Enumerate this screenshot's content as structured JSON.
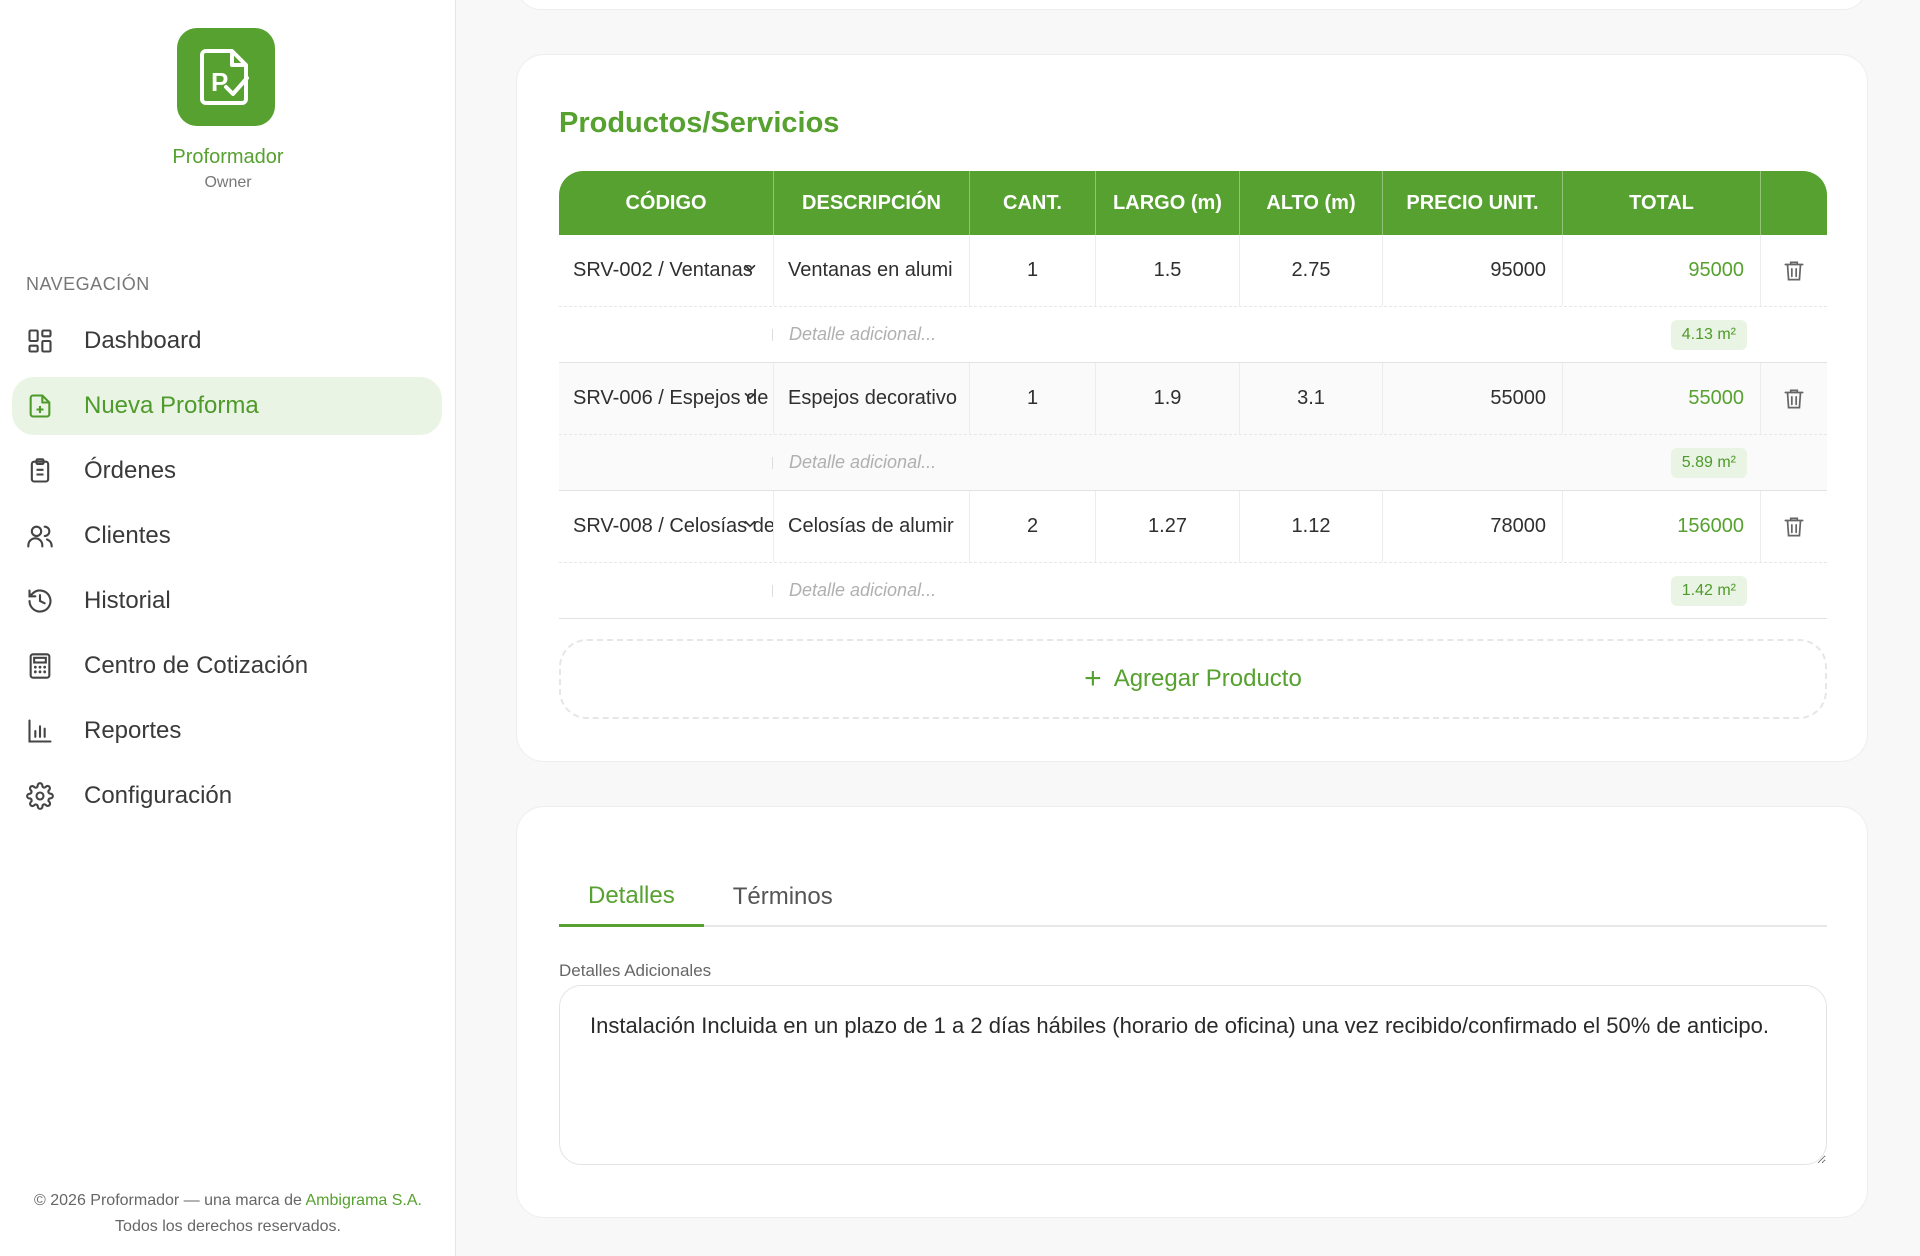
{
  "brand": {
    "name": "Proformador",
    "role": "Owner",
    "logo_letter": "P"
  },
  "nav": {
    "heading": "NAVEGACIÓN",
    "items": [
      {
        "label": "Dashboard",
        "icon": "dashboard-icon",
        "active": false
      },
      {
        "label": "Nueva Proforma",
        "icon": "file-plus-icon",
        "active": true
      },
      {
        "label": "Órdenes",
        "icon": "clipboard-icon",
        "active": false
      },
      {
        "label": "Clientes",
        "icon": "users-icon",
        "active": false
      },
      {
        "label": "Historial",
        "icon": "history-icon",
        "active": false
      },
      {
        "label": "Centro de Cotización",
        "icon": "calculator-icon",
        "active": false
      },
      {
        "label": "Reportes",
        "icon": "bar-chart-icon",
        "active": false
      },
      {
        "label": "Configuración",
        "icon": "gear-icon",
        "active": false
      }
    ]
  },
  "footer": {
    "prefix": "© 2026 Proformador — una marca de ",
    "company": "Ambigrama S.A.",
    "suffix": " Todos los derechos reservados."
  },
  "products": {
    "title": "Productos/Servicios",
    "columns": [
      "CÓDIGO",
      "DESCRIPCIÓN",
      "CANT.",
      "LARGO (m)",
      "ALTO (m)",
      "PRECIO UNIT.",
      "TOTAL",
      ""
    ],
    "rows": [
      {
        "code": "SRV-002 / Ventanas",
        "description": "Ventanas en alumi",
        "qty": "1",
        "length": "1.5",
        "height": "2.75",
        "unit_price": "95000",
        "total": "95000",
        "detail_placeholder": "Detalle adicional...",
        "area": "4.13 m²"
      },
      {
        "code": "SRV-006 / Espejos de",
        "description": "Espejos decorativo",
        "qty": "1",
        "length": "1.9",
        "height": "3.1",
        "unit_price": "55000",
        "total": "55000",
        "detail_placeholder": "Detalle adicional...",
        "area": "5.89 m²"
      },
      {
        "code": "SRV-008 / Celosías de",
        "description": "Celosías de alumir",
        "qty": "2",
        "length": "1.27",
        "height": "1.12",
        "unit_price": "78000",
        "total": "156000",
        "detail_placeholder": "Detalle adicional...",
        "area": "1.42 m²"
      }
    ],
    "add_label": "Agregar Producto"
  },
  "details": {
    "tabs": [
      {
        "label": "Detalles",
        "active": true
      },
      {
        "label": "Términos",
        "active": false
      }
    ],
    "field_label": "Detalles Adicionales",
    "field_value": "Instalación Incluida en un plazo de 1 a 2 días hábiles (horario de oficina) una vez recibido/confirmado el 50% de anticipo."
  },
  "colors": {
    "accent": "#56a12f",
    "accent_light": "#eaf4e4"
  }
}
